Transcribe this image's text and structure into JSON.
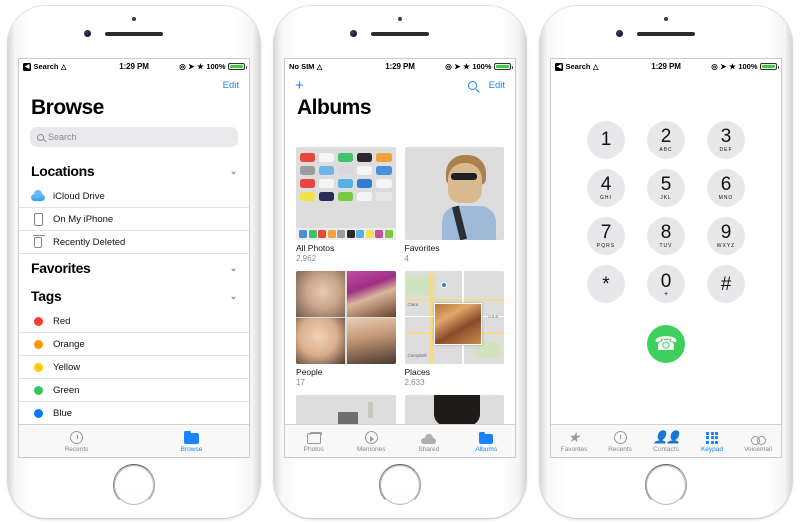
{
  "phones": [
    {
      "id": "files-app",
      "status_bar": {
        "carrier": "Search",
        "back_chip": "◀",
        "time": "1:29 PM",
        "battery": "100%"
      },
      "nav": {
        "action": "Edit"
      },
      "title": "Browse",
      "search": {
        "placeholder": "Search"
      },
      "sections": [
        {
          "header": "Locations",
          "rows": [
            {
              "label": "iCloud Drive",
              "icon": "icloud-icon"
            },
            {
              "label": "On My iPhone",
              "icon": "iphone-icon"
            },
            {
              "label": "Recently Deleted",
              "icon": "trash-icon"
            }
          ]
        },
        {
          "header": "Favorites",
          "rows": []
        },
        {
          "header": "Tags",
          "rows": [
            {
              "label": "Red",
              "color": "#ff3b30"
            },
            {
              "label": "Orange",
              "color": "#ff9500"
            },
            {
              "label": "Yellow",
              "color": "#ffcc00"
            },
            {
              "label": "Green",
              "color": "#34c759"
            },
            {
              "label": "Blue",
              "color": "#007aff"
            }
          ]
        }
      ],
      "tabs": [
        {
          "label": "Recents",
          "icon": "clock-icon",
          "selected": false
        },
        {
          "label": "Browse",
          "icon": "folder-icon",
          "selected": true
        }
      ]
    },
    {
      "id": "photos-app",
      "status_bar": {
        "carrier": "No SIM",
        "time": "1:29 PM",
        "battery": "100%"
      },
      "nav": {
        "add": "+",
        "search_icon": "search-icon",
        "action": "Edit"
      },
      "title": "Albums",
      "albums": [
        {
          "name": "All Photos",
          "count": "2,962",
          "thumb": "ipad-home-screen"
        },
        {
          "name": "Favorites",
          "count": "4",
          "thumb": "car-selfie"
        },
        {
          "name": "People",
          "count": "17",
          "thumb": "people-collage"
        },
        {
          "name": "Places",
          "count": "2,633",
          "thumb": "map-with-photo"
        },
        {
          "name": "",
          "count": "",
          "thumb": "room-interior"
        },
        {
          "name": "",
          "count": "",
          "thumb": "face-glasses"
        }
      ],
      "tabs": [
        {
          "label": "Photos",
          "icon": "photos-icon",
          "selected": false
        },
        {
          "label": "Memories",
          "icon": "memories-icon",
          "selected": false
        },
        {
          "label": "Shared",
          "icon": "cloud-icon",
          "selected": false
        },
        {
          "label": "Albums",
          "icon": "albums-icon",
          "selected": true
        }
      ]
    },
    {
      "id": "phone-app",
      "status_bar": {
        "carrier": "Search",
        "back_chip": "◀",
        "time": "1:29 PM",
        "battery": "100%"
      },
      "keys": [
        {
          "digit": "1",
          "sub": ""
        },
        {
          "digit": "2",
          "sub": "ABC"
        },
        {
          "digit": "3",
          "sub": "DEF"
        },
        {
          "digit": "4",
          "sub": "GHI"
        },
        {
          "digit": "5",
          "sub": "JKL"
        },
        {
          "digit": "6",
          "sub": "MNO"
        },
        {
          "digit": "7",
          "sub": "PQRS"
        },
        {
          "digit": "8",
          "sub": "TUV"
        },
        {
          "digit": "9",
          "sub": "WXYZ"
        },
        {
          "digit": "*",
          "sub": ""
        },
        {
          "digit": "0",
          "sub": "+"
        },
        {
          "digit": "#",
          "sub": ""
        }
      ],
      "call_button": {
        "icon": "phone-handset-icon",
        "color": "#3ed05a"
      },
      "tabs": [
        {
          "label": "Favorites",
          "icon": "star-icon",
          "selected": false
        },
        {
          "label": "Recents",
          "icon": "clock-icon",
          "selected": false
        },
        {
          "label": "Contacts",
          "icon": "contacts-icon",
          "selected": false
        },
        {
          "label": "Keypad",
          "icon": "keypad-icon",
          "selected": true
        },
        {
          "label": "Voicemail",
          "icon": "voicemail-icon",
          "selected": false
        }
      ]
    }
  ],
  "colors": {
    "accent": "#1a84ff",
    "green": "#3ed05a",
    "inactive": "#8a8a8e"
  }
}
